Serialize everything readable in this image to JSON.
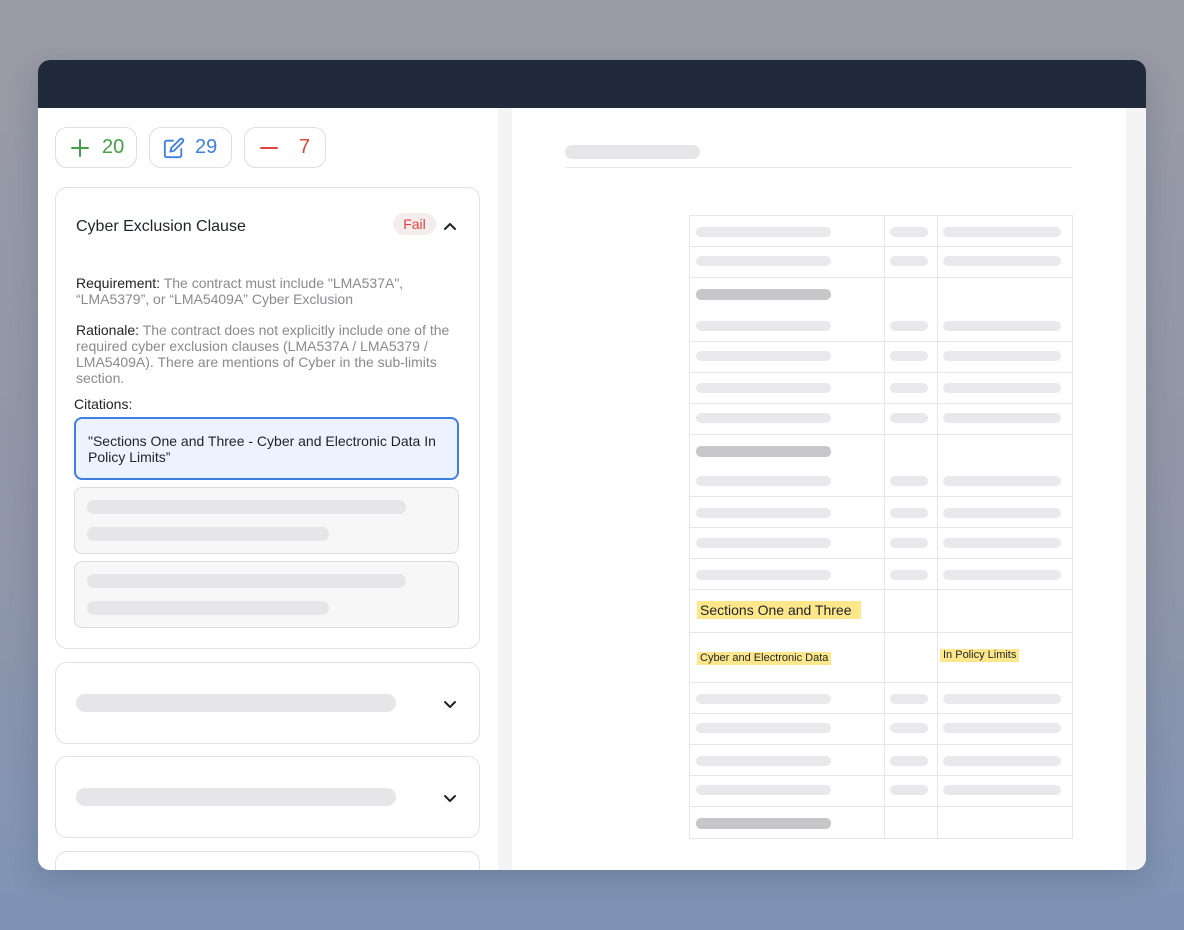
{
  "counters": {
    "added": "20",
    "edited": "29",
    "removed": "7",
    "colors": {
      "added": "#43a047",
      "edited": "#3f7fe0",
      "removed": "#e0443e"
    }
  },
  "check": {
    "title": "Cyber Exclusion Clause",
    "status": "Fail",
    "requirement_label": "Requirement:",
    "requirement_text": "The contract must include \"LMA537A\", “LMA5379”, or “LMA5409A” Cyber Exclusion",
    "rationale_label": "Rationale:",
    "rationale_text": "The contract does not explicitly include one of the required cyber exclusion clauses (LMA537A / LMA5379 / LMA5409A). There are mentions of Cyber in the sub-limits section.",
    "citations_label": "Citations:",
    "active_citation": "\"Sections One and Three - Cyber and Electronic Data In Policy Limits”"
  },
  "document": {
    "highlights": {
      "section": "Sections One and Three",
      "item": "Cyber and Electronic Data",
      "limit": "In Policy Limits"
    },
    "highlight_color": "#fde78a"
  },
  "icons": {
    "added": "plus-icon",
    "edited": "edit-icon",
    "removed": "minus-icon",
    "collapse": "chevron-up-icon",
    "expand": "chevron-down-icon"
  }
}
